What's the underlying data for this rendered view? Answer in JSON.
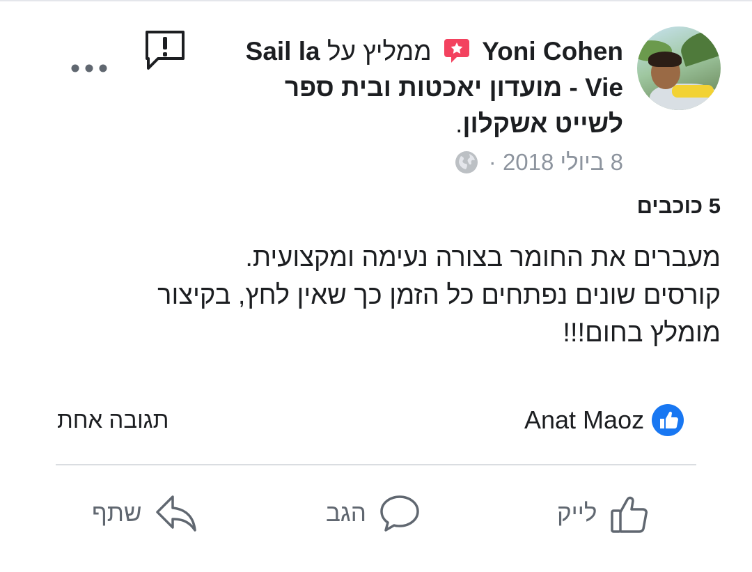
{
  "post": {
    "author": "Yoni Cohen",
    "recommends_text": "ממליץ על",
    "page_name": "Sail la Vie - מועדון יאכטות ובית ספר לשייט אשקלון",
    "period": ".",
    "date": "8 ביולי 2018",
    "separator": "·",
    "rating": "5 כוכבים",
    "body": "מעברים את החומר בצורה נעימה ומקצועית.\nקורסים שונים נפתחים כל הזמן כך שאין לחץ, בקיצור\nמומלץ בחום!!!"
  },
  "reactions": {
    "liker": "Anat Maoz",
    "comments_label": "תגובה אחת"
  },
  "actions": {
    "like_label": "לייק",
    "comment_label": "הגב",
    "share_label": "שתף"
  },
  "colors": {
    "accent_blue": "#1877f2",
    "recommend_red": "#f3425f",
    "muted_text": "#606770"
  },
  "icons": [
    "report-icon",
    "more-options-icon",
    "recommend-icon",
    "globe-icon",
    "like-badge-icon",
    "thumbs-up-icon",
    "comment-bubble-icon",
    "share-arrow-icon"
  ]
}
